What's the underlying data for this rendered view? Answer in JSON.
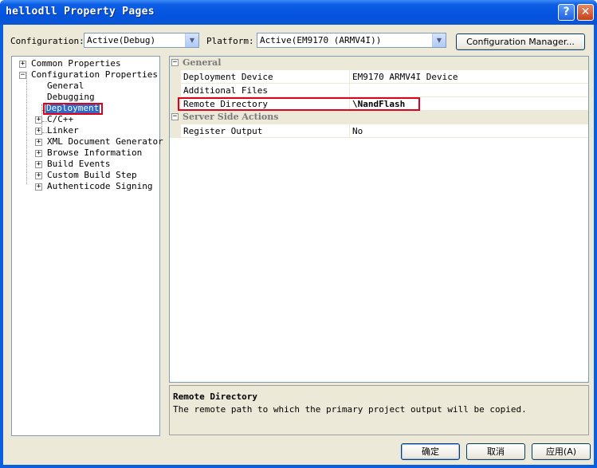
{
  "window": {
    "title": "hellodll Property Pages",
    "help_label": "?",
    "close_label": "✕"
  },
  "config_bar": {
    "configuration_label": "Configuration:",
    "configuration_value": "Active(Debug)",
    "platform_label": "Platform:",
    "platform_value": "Active(EM9170 (ARMV4I))",
    "config_manager_label": "Configuration Manager..."
  },
  "tree": {
    "common_properties": "Common Properties",
    "configuration_properties": "Configuration Properties",
    "general": "General",
    "debugging": "Debugging",
    "deployment": "Deployment",
    "cpp": "C/C++",
    "linker": "Linker",
    "xml_doc": "XML Document Generator",
    "browse_info": "Browse Information",
    "build_events": "Build Events",
    "custom_build": "Custom Build Step",
    "authenticode": "Authenticode Signing"
  },
  "grid": {
    "cat_general": "General",
    "deployment_device": {
      "name": "Deployment Device",
      "value": "EM9170 ARMV4I Device"
    },
    "additional_files": {
      "name": "Additional Files",
      "value": ""
    },
    "remote_directory": {
      "name": "Remote Directory",
      "value": "\\NandFlash"
    },
    "cat_server": "Server Side Actions",
    "register_output": {
      "name": "Register Output",
      "value": "No"
    }
  },
  "description": {
    "title": "Remote Directory",
    "text": "The remote path to which the primary project output will be copied."
  },
  "buttons": {
    "ok": "确定",
    "cancel": "取消",
    "apply": "应用(A)"
  }
}
